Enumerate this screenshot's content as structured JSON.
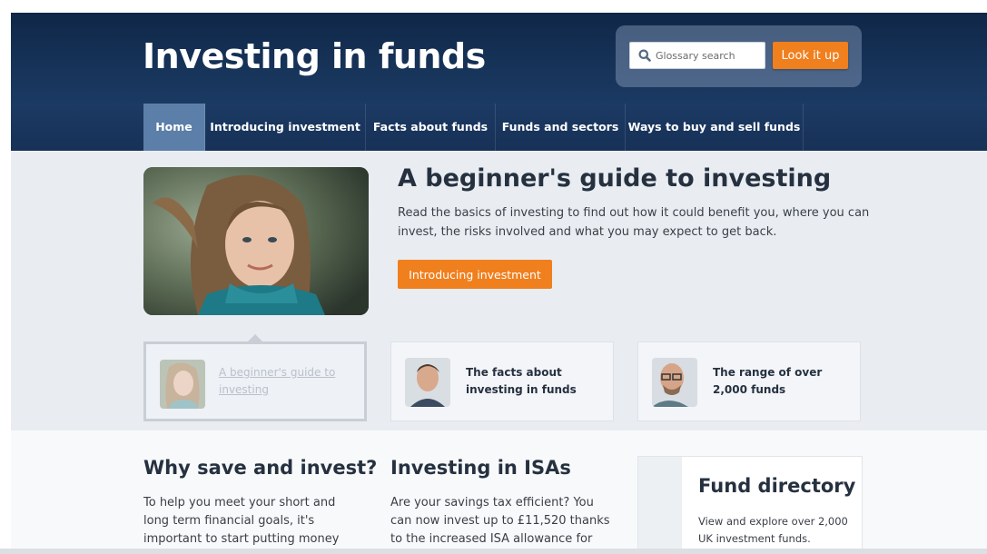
{
  "header": {
    "site_title": "Investing in funds",
    "search_placeholder": "Glossary search",
    "lookup_label": "Look it up"
  },
  "nav": {
    "items": [
      {
        "label": "Home",
        "active": true
      },
      {
        "label": "Introducing investment",
        "active": false
      },
      {
        "label": "Facts about funds",
        "active": false
      },
      {
        "label": "Funds and sectors",
        "active": false
      },
      {
        "label": "Ways to buy and sell funds",
        "active": false
      }
    ]
  },
  "hero": {
    "heading": "A beginner's guide to investing",
    "text": "Read the basics of investing to find out how it could benefit you, where you can invest, the risks involved and what you may expect to get back.",
    "cta_label": "Introducing investment"
  },
  "cards": [
    {
      "label": "A beginner's guide to investing",
      "active": true
    },
    {
      "label": "The facts about investing in funds",
      "active": false
    },
    {
      "label": "The range of over 2,000 funds",
      "active": false
    }
  ],
  "lower": {
    "why": {
      "heading": "Why save and invest?",
      "text": "To help you meet your short and long term financial goals, it's important to start putting money"
    },
    "isas": {
      "heading": "Investing in ISAs",
      "text": "Are your savings tax efficient? You can now invest up to £11,520 thanks to the increased ISA allowance for"
    },
    "fund_directory": {
      "heading": "Fund directory",
      "text": "View and explore over 2,000 UK investment funds."
    }
  },
  "colors": {
    "header_dark": "#0f2748",
    "nav_active": "#5b7fa8",
    "accent_orange": "#f07f1e",
    "hero_bg": "#e9edf2"
  }
}
